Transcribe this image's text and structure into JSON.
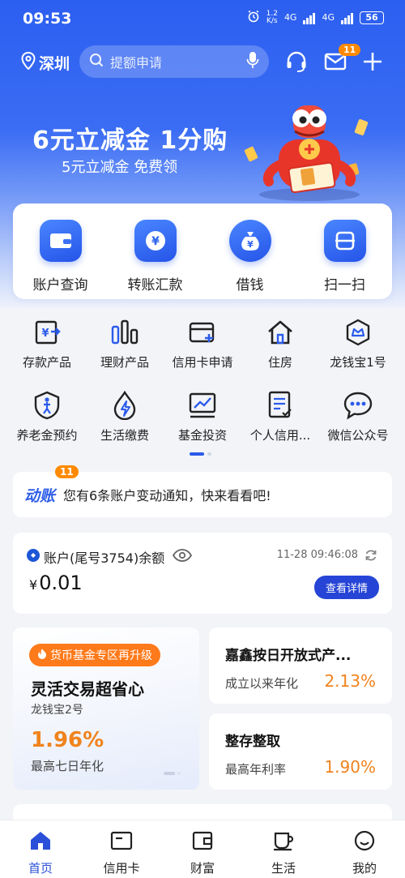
{
  "status_bar": {
    "time": "09:53",
    "speed_value": "1.2",
    "speed_unit": "K/s",
    "net1": "4G",
    "net2": "4G",
    "battery": "56"
  },
  "topbar": {
    "city": "深圳",
    "search_placeholder": "提额申请",
    "mail_badge": "11"
  },
  "banner": {
    "title": "6元立减金 1分购",
    "subtitle": "5元立减金 免费领"
  },
  "main_actions": [
    {
      "label": "账户查询",
      "icon": "wallet-icon"
    },
    {
      "label": "转账汇款",
      "icon": "yen-transfer-icon"
    },
    {
      "label": "借钱",
      "icon": "money-bag-icon"
    },
    {
      "label": "扫一扫",
      "icon": "scan-icon"
    }
  ],
  "grid_row1": [
    {
      "label": "存款产品",
      "icon": "deposit-icon"
    },
    {
      "label": "理财产品",
      "icon": "bar-chart-icon"
    },
    {
      "label": "信用卡申请",
      "icon": "card-add-icon"
    },
    {
      "label": "住房",
      "icon": "house-icon"
    },
    {
      "label": "龙钱宝1号",
      "icon": "crown-shield-icon"
    }
  ],
  "grid_row2": [
    {
      "label": "养老金预约",
      "icon": "elder-icon"
    },
    {
      "label": "生活缴费",
      "icon": "bolt-drop-icon"
    },
    {
      "label": "基金投资",
      "icon": "trend-chart-icon"
    },
    {
      "label": "个人信用...",
      "icon": "credit-doc-icon"
    },
    {
      "label": "微信公众号",
      "icon": "chat-bubble-icon"
    }
  ],
  "notice": {
    "tag": "动账",
    "badge": "11",
    "message": "您有6条账户变动通知，快来看看吧!"
  },
  "account": {
    "title": "账户(尾号3754)余额",
    "timestamp": "11-28 09:46:08",
    "currency": "¥",
    "balance": "0.01",
    "detail_button": "查看详情"
  },
  "product_left": {
    "pill": "货币基金专区再升级",
    "headline": "灵活交易超省心",
    "name": "龙钱宝2号",
    "rate": "1.96%",
    "rate_label": "最高七日年化"
  },
  "product_right": [
    {
      "title": "嘉鑫按日开放式产...",
      "label": "成立以来年化",
      "rate": "2.13%"
    },
    {
      "title": "整存整取",
      "label": "最高年利率",
      "rate": "1.90%"
    }
  ],
  "bottom_nav": [
    {
      "label": "首页",
      "icon": "home-icon",
      "active": true
    },
    {
      "label": "信用卡",
      "icon": "credit-card-icon",
      "active": false
    },
    {
      "label": "财富",
      "icon": "wealth-wallet-icon",
      "active": false
    },
    {
      "label": "生活",
      "icon": "cup-icon",
      "active": false
    },
    {
      "label": "我的",
      "icon": "smile-icon",
      "active": false
    }
  ],
  "colors": {
    "brand": "#2c5ff0",
    "accent_orange": "#f0831d",
    "nav_active": "#2a4fd8"
  }
}
